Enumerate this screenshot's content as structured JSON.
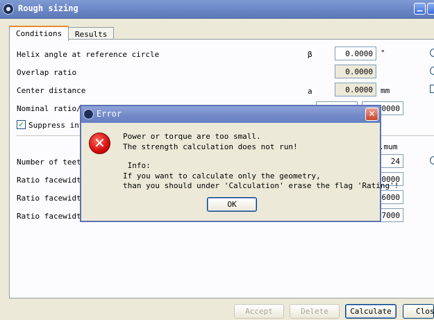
{
  "window": {
    "title": "Rough sizing"
  },
  "tabs": [
    {
      "label": "Conditions"
    },
    {
      "label": "Results"
    }
  ],
  "rows": {
    "helix": {
      "label": "Helix angle at reference circle",
      "symbol": "β",
      "value": "0.0000",
      "unit": "°"
    },
    "overlap": {
      "label": "Overlap ratio",
      "value": "0.0000"
    },
    "center": {
      "label": "Center distance",
      "symbol": "a",
      "value": "0.0000",
      "unit": "mm"
    },
    "nominal": {
      "label": "Nominal ratio/d",
      "value2": "0000"
    },
    "suppress": {
      "label": "Suppress int",
      "checked": true
    },
    "column_header": ".mum",
    "teeth": {
      "label": "Number of teeth",
      "value": "24"
    },
    "ratio1": {
      "label": "Ratio facewidth",
      "value": "0000"
    },
    "ratio2": {
      "label": "Ratio facewidth",
      "value": "6000"
    },
    "ratio3": {
      "label": "Ratio facewidth",
      "value": "7000"
    }
  },
  "buttons": {
    "accept": "Accept",
    "delete": "Delete",
    "calculate": "Calculate",
    "close": "Clos"
  },
  "error_dialog": {
    "title": "Error",
    "lines": [
      "Power or torque are too small.",
      "The strength calculation does not run!",
      " Info:",
      "If you want to calculate only the geometry,",
      "than you should under 'Calculation' erase the flag 'Rating'!"
    ],
    "ok_label": "OK"
  },
  "colors": {
    "title_bar": "#6a86c4",
    "error_icon": "#d40d0d",
    "tab_accent": "#e68b2c"
  },
  "icons": [
    "app-icon",
    "minimize-icon",
    "close-icon",
    "error-icon",
    "check-icon"
  ]
}
